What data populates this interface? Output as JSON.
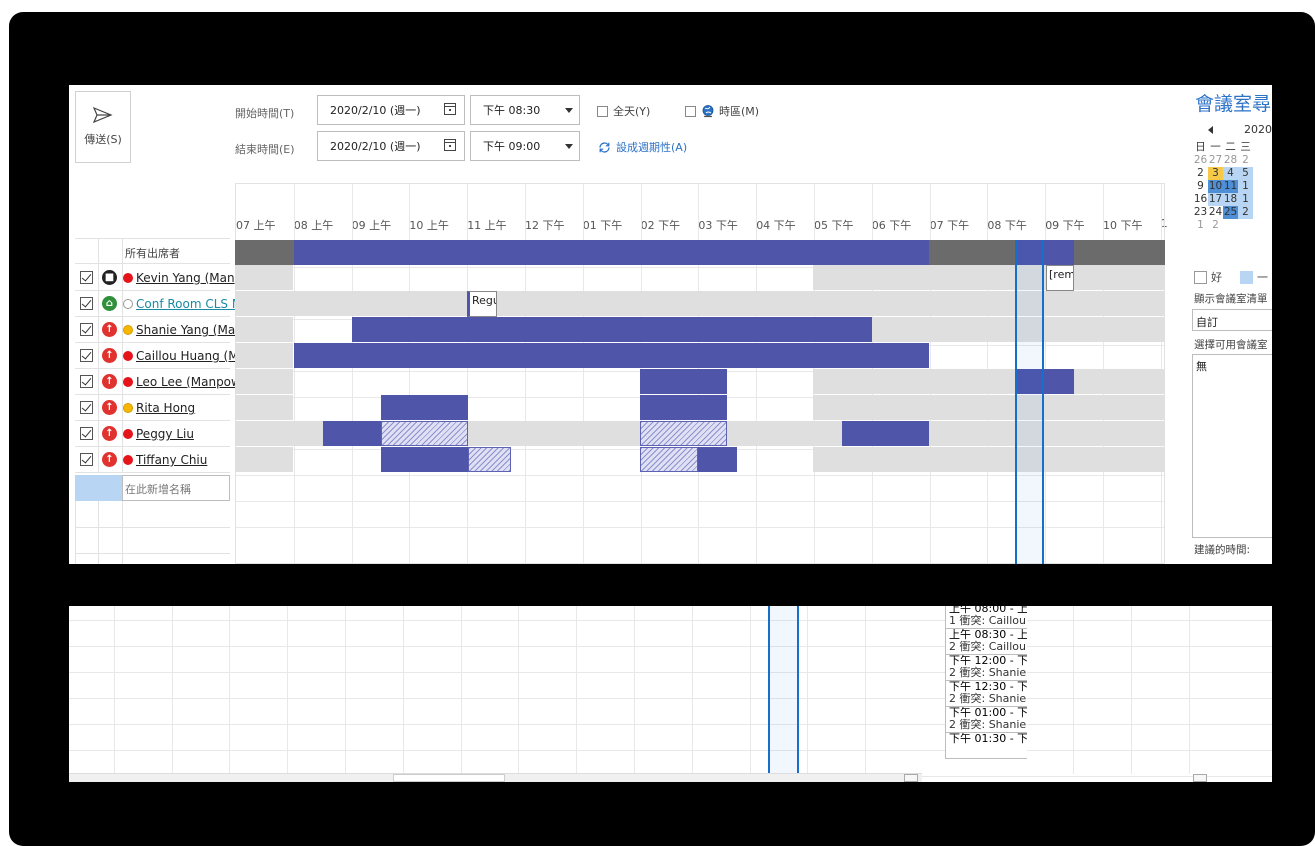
{
  "toolbar": {
    "send_label": "傳送(S)"
  },
  "time_fields": {
    "start_label": "開始時間(T)",
    "start_date": "2020/2/10 (週一)",
    "start_time": "下午 08:30",
    "end_label": "結束時間(E)",
    "end_date": "2020/2/10 (週一)",
    "end_time": "下午 09:00",
    "all_day_label": "全天(Y)",
    "timezone_label": "時區(M)",
    "recurrence_label": "設成週期性(A)"
  },
  "hours": [
    "07 上午",
    "08 上午",
    "09 上午",
    "10 上午",
    "11 上午",
    "12 下午",
    "01 下午",
    "02 下午",
    "03 下午",
    "04 下午",
    "05 下午",
    "06 下午",
    "07 下午",
    "08 下午",
    "09 下午",
    "10 下午",
    "1"
  ],
  "attendees_header": "所有出席者",
  "attendees": [
    {
      "name": "Kevin Yang (Manp",
      "role": "black",
      "status": "red"
    },
    {
      "name": "Conf Room CLS M",
      "role": "green",
      "status": "hollow"
    },
    {
      "name": "Shanie Yang (Mar",
      "role": "red",
      "status": "yellow"
    },
    {
      "name": "Caillou Huang (M",
      "role": "red",
      "status": "red"
    },
    {
      "name": "Leo Lee (Manpow",
      "role": "red",
      "status": "red"
    },
    {
      "name": "Rita Hong",
      "role": "red",
      "status": "yellow"
    },
    {
      "name": "Peggy Liu",
      "role": "red",
      "status": "red"
    },
    {
      "name": "Tiffany Chiu",
      "role": "red",
      "status": "red"
    }
  ],
  "add_name_placeholder": "在此新增名稱",
  "tooltips": {
    "kevin": "[rem",
    "room": "Regu"
  },
  "right_panel": {
    "title": "會議室尋",
    "year": "2020",
    "weekdays": [
      "日",
      "一",
      "二",
      "三"
    ],
    "weeks": [
      [
        "26",
        "27",
        "28",
        "2"
      ],
      [
        "2",
        "3",
        "4",
        "5"
      ],
      [
        "9",
        "10",
        "11",
        "1"
      ],
      [
        "16",
        "17",
        "18",
        "1"
      ],
      [
        "23",
        "24",
        "25",
        "2"
      ],
      [
        "1",
        "2",
        "",
        ""
      ]
    ],
    "legend_good": "好",
    "legend_fair": "一",
    "show_rooms_label": "顯示會議室清單",
    "custom_value": "自訂",
    "choose_room_label": "選擇可用會議室",
    "none_value": "無",
    "suggested_label": "建議的時間:"
  },
  "suggestions": [
    {
      "time": "上午 08:00 - 上",
      "conflict": "1 衝突: Caillou"
    },
    {
      "time": "上午 08:30 - 上",
      "conflict": "2 衝突: Caillou"
    },
    {
      "time": "下午 12:00 - 下",
      "conflict": "2 衝突: Shanie"
    },
    {
      "time": "下午 12:30 - 下",
      "conflict": "2 衝突: Shanie"
    },
    {
      "time": "下午 01:00 - 下",
      "conflict": "2 衝突: Shanie"
    },
    {
      "time": "下午 01:30 - 下",
      "conflict": ""
    }
  ],
  "colors": {
    "busy": "#4f56aa",
    "tentative": "#dfe0f3",
    "offhours": "#dfdfdf",
    "selection": "#1670c9",
    "accent": "#2c72c7"
  }
}
